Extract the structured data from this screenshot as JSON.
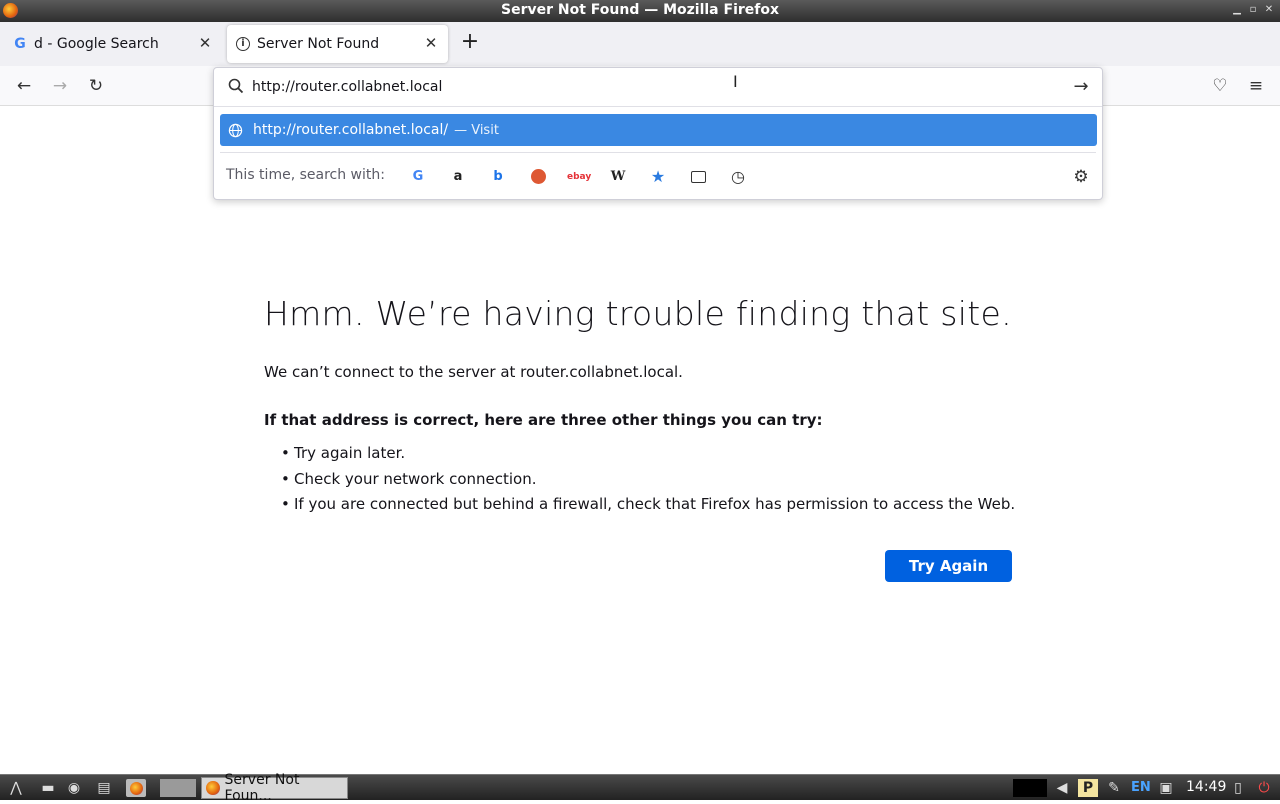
{
  "window": {
    "title": "Server Not Found — Mozilla Firefox"
  },
  "tabs": [
    {
      "label": "d - Google Search",
      "icon": "google-icon"
    },
    {
      "label": "Server Not Found",
      "icon": "info-icon"
    }
  ],
  "urlbar": {
    "value": "http://router.collabnet.local",
    "suggestion": {
      "url": "http://router.collabnet.local/",
      "action": "— Visit"
    },
    "search_with_label": "This time, search with:",
    "engines": [
      "google-icon",
      "amazon-icon",
      "bing-icon",
      "duckduckgo-icon",
      "ebay-icon",
      "wikipedia-icon",
      "bookmarks-icon",
      "tabs-icon",
      "history-icon"
    ]
  },
  "error_page": {
    "title": "Hmm. We’re having trouble finding that site.",
    "description": "We can’t connect to the server at router.collabnet.local.",
    "subtitle": "If that address is correct, here are three other things you can try:",
    "suggestions": [
      "Try again later.",
      "Check your network connection.",
      "If you are connected but behind a firewall, check that Firefox has permission to access the Web."
    ],
    "button_label": "Try Again"
  },
  "taskbar": {
    "task_label": "Server Not Foun...",
    "language": "EN",
    "clock": "14:49"
  },
  "colors": {
    "accent": "#0061e0",
    "highlight": "#3a88e2"
  }
}
